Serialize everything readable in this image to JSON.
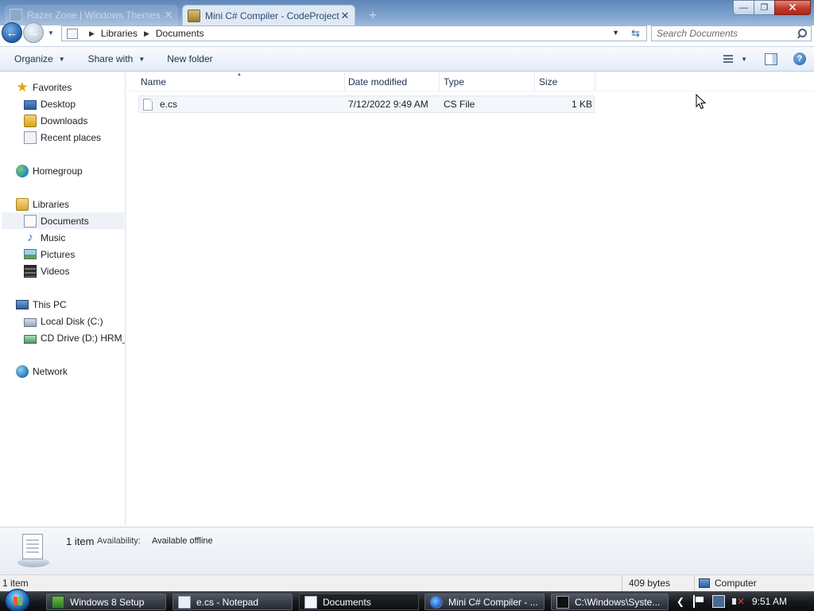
{
  "browser": {
    "tabs": [
      {
        "label": "Razer Zone | Windows Themes",
        "state": "inactive"
      },
      {
        "label": "Mini C# Compiler - CodeProject",
        "state": "active"
      }
    ],
    "new_tab": "+"
  },
  "window_controls": {
    "minimize": "—",
    "maximize": "❐",
    "close": "✕"
  },
  "nav": {
    "back": "←",
    "forward": "→",
    "breadcrumb": [
      "Libraries",
      "Documents"
    ],
    "search_placeholder": "Search Documents"
  },
  "commands": {
    "organize": "Organize",
    "share_with": "Share with",
    "new_folder": "New folder",
    "help": "?"
  },
  "sidebar": {
    "favorites": {
      "label": "Favorites",
      "items": [
        "Desktop",
        "Downloads",
        "Recent places"
      ]
    },
    "homegroup": "Homegroup",
    "libraries": {
      "label": "Libraries",
      "items": [
        "Documents",
        "Music",
        "Pictures",
        "Videos"
      ],
      "selected": "Documents"
    },
    "this_pc": {
      "label": "This PC",
      "items": [
        "Local Disk (C:)",
        "CD Drive (D:) HRM_C"
      ]
    },
    "network": "Network"
  },
  "file_list": {
    "columns": [
      "Name",
      "Date modified",
      "Type",
      "Size"
    ],
    "sort_column": "Name",
    "rows": [
      {
        "name": "e.cs",
        "date_modified": "7/12/2022 9:49 AM",
        "type": "CS File",
        "size": "1 KB"
      }
    ]
  },
  "details_pane": {
    "count": "1 item",
    "availability_label": "Availability:",
    "availability_value": "Available offline"
  },
  "status_bar": {
    "items": "1 item",
    "size": "409 bytes",
    "location": "Computer"
  },
  "taskbar": {
    "buttons": [
      {
        "label": "Windows 8 Setup",
        "icon": "setup-icon"
      },
      {
        "label": "e.cs - Notepad",
        "icon": "notepad-icon"
      },
      {
        "label": "Documents",
        "icon": "explorer-icon",
        "active": true
      },
      {
        "label": "Mini C# Compiler - ...",
        "icon": "browser-icon"
      },
      {
        "label": "C:\\Windows\\Syste...",
        "icon": "cmd-icon"
      }
    ],
    "clock": "9:51 AM"
  },
  "colors": {
    "titlebar": "#7ea2cc",
    "command_bar": "#e3ecf6",
    "selection": "#eef2f7",
    "taskbar": "#15171b"
  }
}
